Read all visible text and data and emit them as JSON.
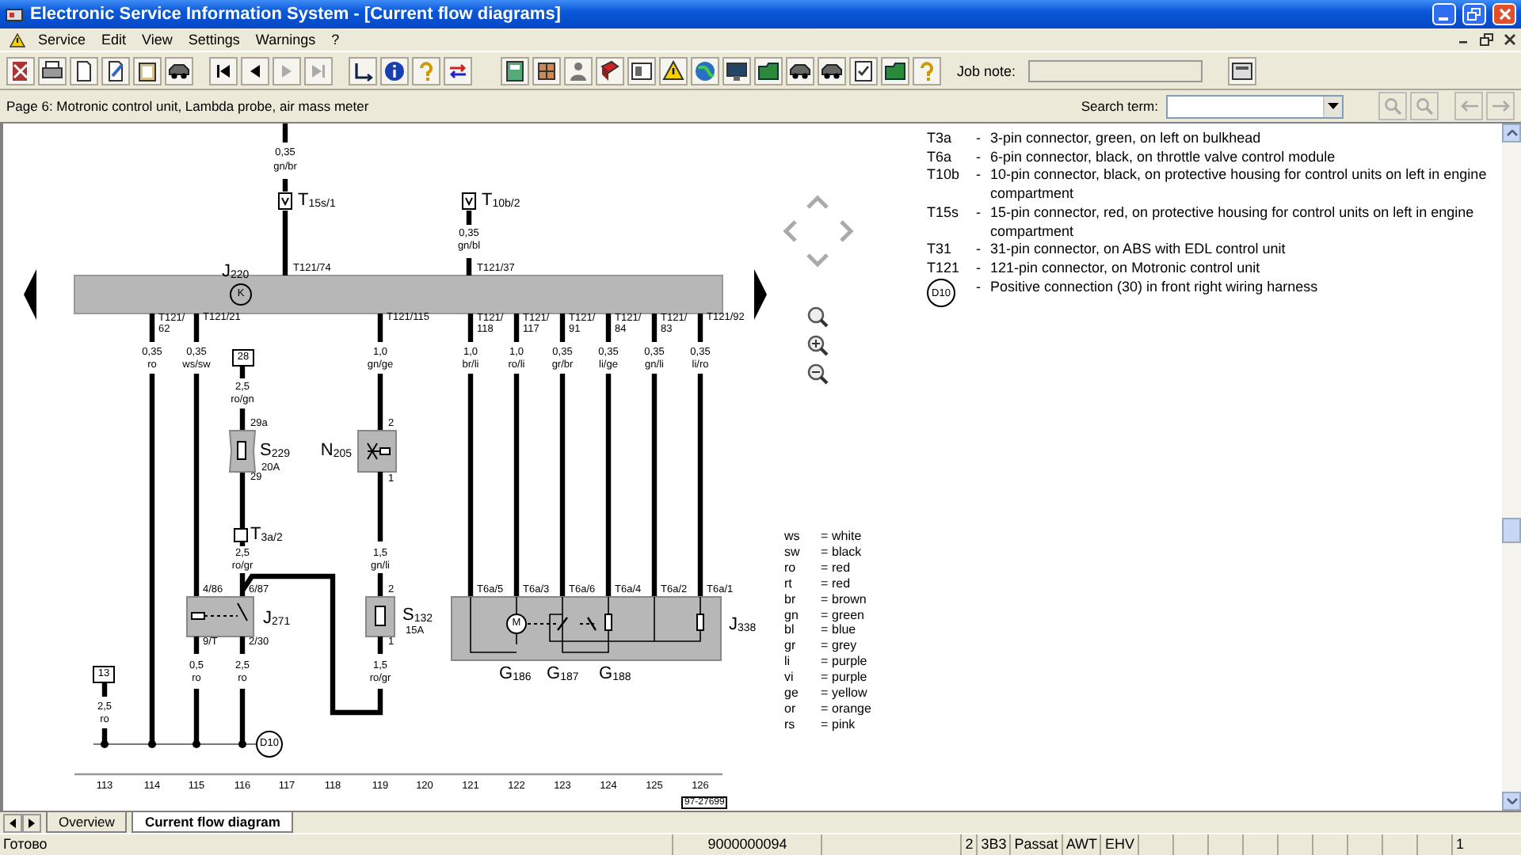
{
  "window": {
    "title": "Electronic Service Information System - [Current flow diagrams]"
  },
  "menu": [
    "Service",
    "Edit",
    "View",
    "Settings",
    "Warnings",
    "?"
  ],
  "toolbar": {
    "job_note_label": "Job note:"
  },
  "page_bar": {
    "title": "Page 6: Motronic control unit, Lambda probe, air mass meter",
    "search_label": "Search term:"
  },
  "diagram": {
    "unit": {
      "name": "J$_{220}$",
      "symbol": "K"
    },
    "top_wires": [
      {
        "connector": "T$_{15s/1}$",
        "gauge": "0,35",
        "wire_code": "gn/br",
        "pin": "T121/74"
      },
      {
        "connector": "T$_{10b/2}$",
        "gauge": "0,35",
        "wire_code": "gn/bl",
        "pin": "T121/37"
      }
    ],
    "bottom_wires": [
      {
        "pin": [
          "T121/",
          "62"
        ],
        "gauge": "0,35",
        "wire_code": "ro"
      },
      {
        "pin": [
          "T121/21"
        ],
        "gauge": "0,35",
        "wire_code": "ws/sw"
      },
      {
        "pin": [
          "T121/115"
        ],
        "gauge": "1,0",
        "wire_code": "gn/ge"
      },
      {
        "pin": [
          "T121/",
          "118"
        ],
        "gauge": "1,0",
        "wire_code": "br/li"
      },
      {
        "pin": [
          "T121/",
          "117"
        ],
        "gauge": "1,0",
        "wire_code": "ro/li"
      },
      {
        "pin": [
          "T121/",
          "91"
        ],
        "gauge": "0,35",
        "wire_code": "gr/br"
      },
      {
        "pin": [
          "T121/",
          "84"
        ],
        "gauge": "0,35",
        "wire_code": "li/ge"
      },
      {
        "pin": [
          "T121/",
          "83"
        ],
        "gauge": "0,35",
        "wire_code": "gn/li"
      },
      {
        "pin": [
          "T121/92"
        ],
        "gauge": "0,35",
        "wire_code": "li/ro"
      }
    ],
    "fuse_s229": {
      "terminal": "28",
      "gauge": "2,5",
      "wire_code": "ro/gn",
      "pin_in": "29a",
      "name": "S$_{229}$",
      "rating": "20A",
      "pin_out": "29"
    },
    "connector_t3a": {
      "name": "T$_{3a/2}$",
      "gauge": "2,5",
      "wire_code": "ro/gr"
    },
    "relay_j271": {
      "name": "J$_{271}$",
      "pins": [
        "4/86",
        "6/87",
        "9/T",
        "2/30"
      ],
      "outputs": [
        {
          "gauge": "0,5",
          "wire_code": "ro"
        },
        {
          "gauge": "2,5",
          "wire_code": "ro"
        }
      ]
    },
    "valve_n205": {
      "name": "N$_{205}$",
      "pins": [
        "2",
        "1"
      ],
      "gauge": "1,5",
      "wire_code": "gn/li"
    },
    "fuse_s132": {
      "name": "S$_{132}$",
      "rating": "15A",
      "pins": [
        "2",
        "1"
      ],
      "gauge": "1,5",
      "wire_code": "ro/gr"
    },
    "terminal_13": {
      "label": "13",
      "gauge": "2,5",
      "wire_code": "ro"
    },
    "ground_point": {
      "label": "D10"
    },
    "module_j338": {
      "name": "J$_{338}$",
      "pins": [
        "T6a/5",
        "T6a/3",
        "T6a/6",
        "T6a/4",
        "T6a/2",
        "T6a/1"
      ],
      "motor_symbol": "M",
      "sensors": [
        "G$_{186}$",
        "G$_{187}$",
        "G$_{188}$"
      ]
    },
    "columns": [
      "113",
      "114",
      "115",
      "116",
      "117",
      "118",
      "119",
      "120",
      "121",
      "122",
      "123",
      "124",
      "125",
      "126"
    ],
    "drawing_number": "97-27699",
    "color_codes": [
      {
        "code": "ws",
        "sign": "=",
        "meaning": "white"
      },
      {
        "code": "sw",
        "sign": "=",
        "meaning": "black"
      },
      {
        "code": "ro",
        "sign": "=",
        "meaning": "red"
      },
      {
        "code": "rt",
        "sign": "=",
        "meaning": "red"
      },
      {
        "code": "br",
        "sign": "=",
        "meaning": "brown"
      },
      {
        "code": "gn",
        "sign": "=",
        "meaning": "green"
      },
      {
        "code": "bl",
        "sign": "=",
        "meaning": "blue"
      },
      {
        "code": "gr",
        "sign": "=",
        "meaning": "grey"
      },
      {
        "code": "li",
        "sign": "=",
        "meaning": "purple"
      },
      {
        "code": "vi",
        "sign": "=",
        "meaning": "purple"
      },
      {
        "code": "ge",
        "sign": "=",
        "meaning": "yellow"
      },
      {
        "code": "or",
        "sign": "=",
        "meaning": "orange"
      },
      {
        "code": "rs",
        "sign": "=",
        "meaning": "pink"
      }
    ]
  },
  "connector_legend": [
    {
      "kind": "text",
      "code": "T3a",
      "dash": "-",
      "description": "3-pin connector, green, on left on bulkhead"
    },
    {
      "kind": "text",
      "code": "T6a",
      "dash": "-",
      "description": "6-pin connector, black, on throttle valve control module"
    },
    {
      "kind": "text",
      "code": "T10b",
      "dash": "-",
      "description": "10-pin connector, black, on protective housing for control units on left in engine compartment"
    },
    {
      "kind": "text",
      "code": "T15s",
      "dash": "-",
      "description": "15-pin connector, red, on protective housing for control units on left in engine compartment"
    },
    {
      "kind": "text",
      "code": "T31",
      "dash": "-",
      "description": "31-pin connector, on ABS with EDL control unit"
    },
    {
      "kind": "text",
      "code": "T121",
      "dash": "-",
      "description": "121-pin connector, on Motronic control unit"
    },
    {
      "kind": "circle",
      "code": "D10",
      "dash": "-",
      "description": "Positive connection (30) in front right wiring harness"
    }
  ],
  "tabs": [
    {
      "label": "Overview",
      "selected": false
    },
    {
      "label": "Current flow diagram",
      "selected": true
    }
  ],
  "status_bar": {
    "message": "Готово",
    "cells": [
      "9000000094",
      "2",
      "3B3",
      "Passat",
      "AWT",
      "EHV",
      "1"
    ]
  }
}
